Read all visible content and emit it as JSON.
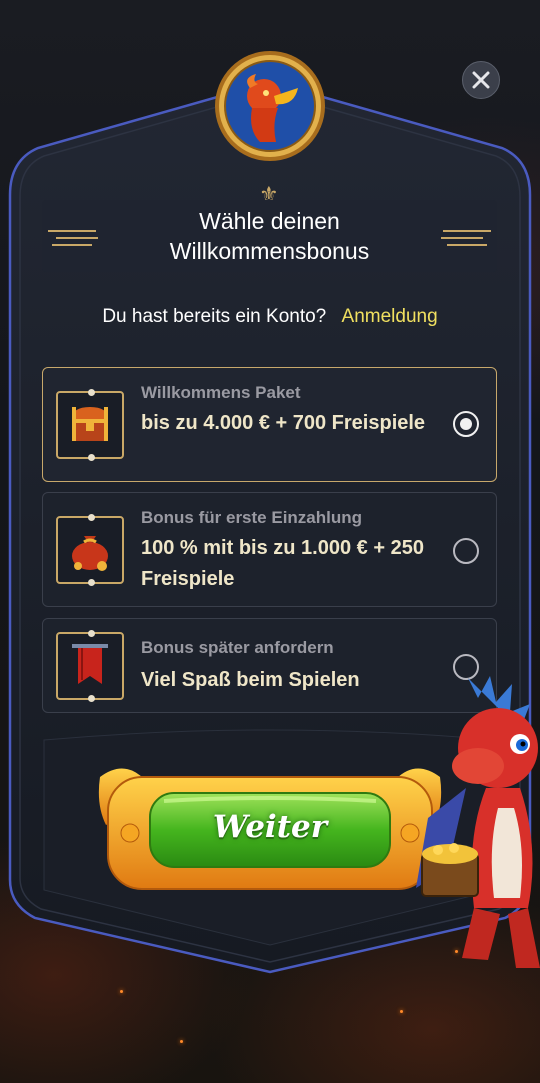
{
  "header": {
    "title": "Wähle deinen Willkommensbonus"
  },
  "account": {
    "question": "Du hast bereits ein Konto?",
    "login_label": "Anmeldung"
  },
  "bonuses": [
    {
      "title": "Willkommens Paket",
      "description": "bis zu 4.000 € + 700 Freispiele",
      "icon": "treasure-chest-icon",
      "selected": true
    },
    {
      "title": "Bonus für erste Einzahlung",
      "description": "100 % mit bis zu 1.000 € + 250 Freispiele",
      "icon": "money-bag-icon",
      "selected": false
    },
    {
      "title": "Bonus später anfordern",
      "description": "Viel Spaß beim Spielen",
      "icon": "banner-flag-icon",
      "selected": false
    }
  ],
  "cta": {
    "label": "Weiter"
  },
  "colors": {
    "accent_gold": "#c9a867",
    "link_yellow": "#f0e060",
    "cta_green": "#3fae1e",
    "panel_bg": "#1b1f29"
  }
}
